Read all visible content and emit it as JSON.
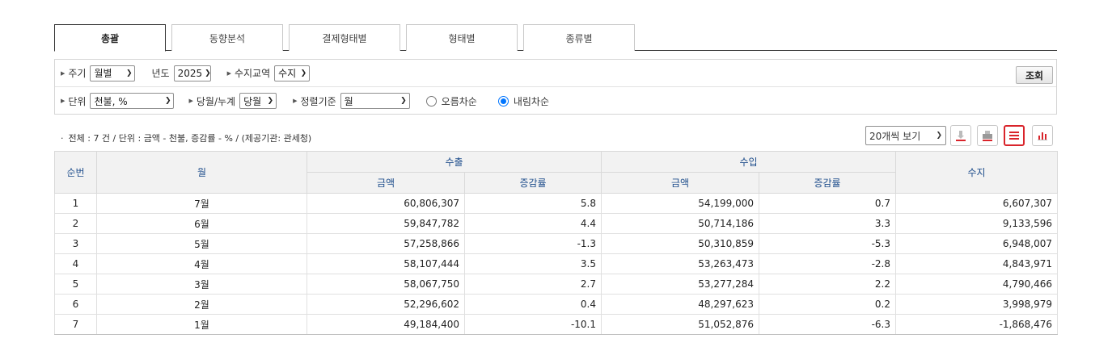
{
  "tabs": [
    "총괄",
    "동향분석",
    "결제형태별",
    "형태별",
    "종류별"
  ],
  "filters": {
    "period_label": "주기",
    "period_value": "월별",
    "year_label": "년도",
    "year_value": "2025",
    "trade_label": "수지교역",
    "trade_value": "수지",
    "search_button": "조회",
    "unit_label": "단위",
    "unit_value": "천불, %",
    "cumulative_label": "당월/누계",
    "cumulative_value": "당월",
    "sort_label": "정렬기준",
    "sort_value": "월",
    "asc_label": "오름차순",
    "desc_label": "내림차순",
    "selected_order": "desc"
  },
  "info": {
    "text": "전체 : 7 건 / 단위 : 금액 - 천불, 증감률 - % / (제공기관: 관세청)"
  },
  "toolbar": {
    "page_size": "20개씩 보기",
    "icons": [
      "download-icon",
      "print-icon",
      "list-view-icon",
      "chart-view-icon"
    ],
    "active_icon": "list-view-icon",
    "accent_color": "#d9242b"
  },
  "table": {
    "headers": {
      "no": "순번",
      "month": "월",
      "export": "수출",
      "import": "수입",
      "balance": "수지",
      "amount": "금액",
      "rate": "증감률"
    },
    "rows": [
      {
        "no": "1",
        "month": "7월",
        "exp_amt": "60,806,307",
        "exp_rate": "5.8",
        "imp_amt": "54,199,000",
        "imp_rate": "0.7",
        "balance": "6,607,307"
      },
      {
        "no": "2",
        "month": "6월",
        "exp_amt": "59,847,782",
        "exp_rate": "4.4",
        "imp_amt": "50,714,186",
        "imp_rate": "3.3",
        "balance": "9,133,596"
      },
      {
        "no": "3",
        "month": "5월",
        "exp_amt": "57,258,866",
        "exp_rate": "-1.3",
        "imp_amt": "50,310,859",
        "imp_rate": "-5.3",
        "balance": "6,948,007"
      },
      {
        "no": "4",
        "month": "4월",
        "exp_amt": "58,107,444",
        "exp_rate": "3.5",
        "imp_amt": "53,263,473",
        "imp_rate": "-2.8",
        "balance": "4,843,971"
      },
      {
        "no": "5",
        "month": "3월",
        "exp_amt": "58,067,750",
        "exp_rate": "2.7",
        "imp_amt": "53,277,284",
        "imp_rate": "2.2",
        "balance": "4,790,466"
      },
      {
        "no": "6",
        "month": "2월",
        "exp_amt": "52,296,602",
        "exp_rate": "0.4",
        "imp_amt": "48,297,623",
        "imp_rate": "0.2",
        "balance": "3,998,979"
      },
      {
        "no": "7",
        "month": "1월",
        "exp_amt": "49,184,400",
        "exp_rate": "-10.1",
        "imp_amt": "51,052,876",
        "imp_rate": "-6.3",
        "balance": "-1,868,476"
      }
    ]
  }
}
